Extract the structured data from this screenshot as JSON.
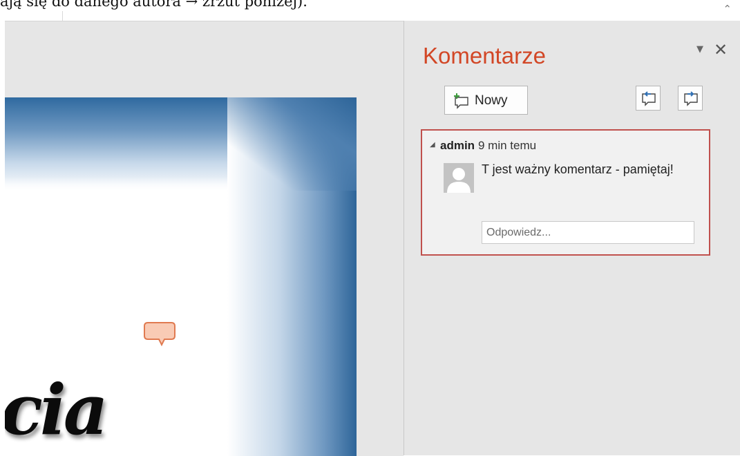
{
  "document": {
    "top_text": "ają się do danego autora → zrzut poniżej).",
    "collapse_icon": "chevron-up-icon"
  },
  "slide": {
    "text": "cia"
  },
  "comments_pane": {
    "title": "Komentarze",
    "menu_icon": "triangle-down-icon",
    "close_icon": "close-icon",
    "new_button_label": "Nowy",
    "prev_icon": "previous-comment-icon",
    "next_icon": "next-comment-icon",
    "comment": {
      "author": "admin",
      "time": "9 min temu",
      "text": "T jest ważny komentarz - pamiętaj!",
      "reply_placeholder": "Odpowiedz..."
    }
  },
  "colors": {
    "accent": "#d24726",
    "card_border": "#c0504d",
    "marker_fill": "#f9cbb5",
    "slide_blue": "#2e6599"
  }
}
